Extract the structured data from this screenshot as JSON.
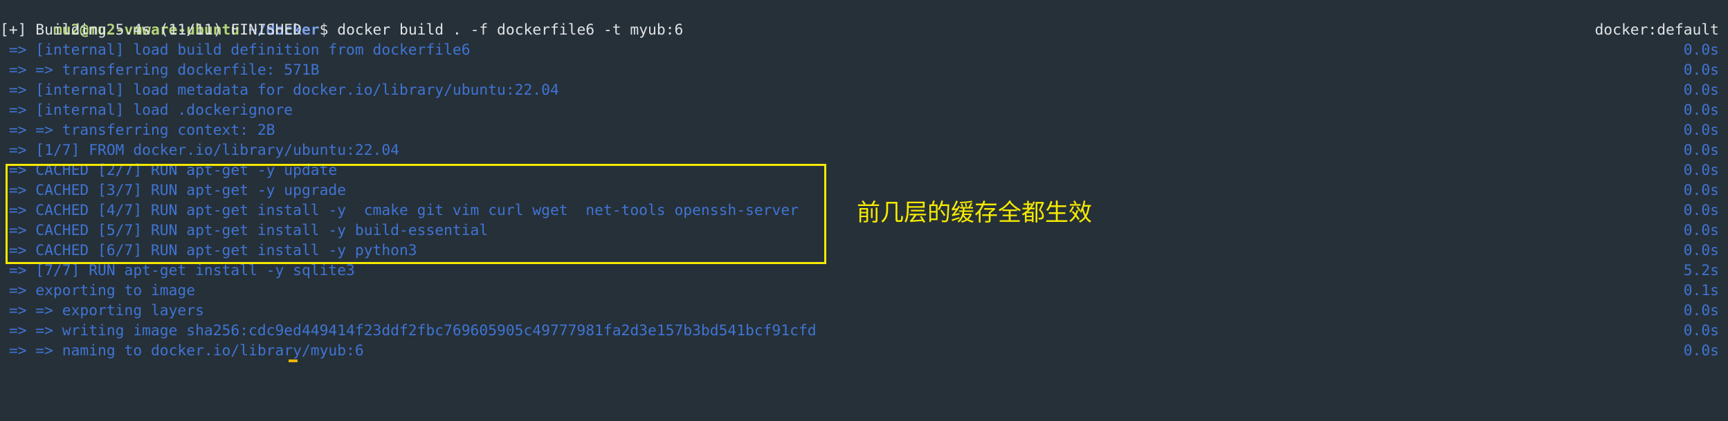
{
  "prompt": {
    "user_host": "mu2@mu2-vmware-ubuntu",
    "separator": ":",
    "path": "~/docker",
    "symbol": "$",
    "command": " docker build . -f dockerfile6 -t myub:6"
  },
  "status": {
    "text": "[+] Building 5.4s (11/11) FINISHED",
    "builder": "docker:default"
  },
  "steps": [
    {
      "text": " => [internal] load build definition from dockerfile6",
      "time": "0.0s"
    },
    {
      "text": " => => transferring dockerfile: 571B",
      "time": "0.0s"
    },
    {
      "text": " => [internal] load metadata for docker.io/library/ubuntu:22.04",
      "time": "0.0s"
    },
    {
      "text": " => [internal] load .dockerignore",
      "time": "0.0s"
    },
    {
      "text": " => => transferring context: 2B",
      "time": "0.0s"
    },
    {
      "text": " => [1/7] FROM docker.io/library/ubuntu:22.04",
      "time": "0.0s"
    },
    {
      "text": " => CACHED [2/7] RUN apt-get -y update",
      "time": "0.0s"
    },
    {
      "text": " => CACHED [3/7] RUN apt-get -y upgrade",
      "time": "0.0s"
    },
    {
      "text": " => CACHED [4/7] RUN apt-get install -y  cmake git vim curl wget  net-tools openssh-server",
      "time": "0.0s"
    },
    {
      "text": " => CACHED [5/7] RUN apt-get install -y build-essential",
      "time": "0.0s"
    },
    {
      "text": " => CACHED [6/7] RUN apt-get install -y python3",
      "time": "0.0s"
    },
    {
      "text": " => [7/7] RUN apt-get install -y sqlite3",
      "time": "5.2s"
    },
    {
      "text": " => exporting to image",
      "time": "0.1s"
    },
    {
      "text": " => => exporting layers",
      "time": "0.0s"
    },
    {
      "text": " => => writing image sha256:cdc9ed449414f23ddf2fbc769605905c49777981fa2d3e157b3bd541bcf91cfd",
      "time": "0.0s"
    },
    {
      "text": " => => naming to docker.io/library/myub:6",
      "time": "0.0s"
    }
  ],
  "annotation": {
    "text": "前几层的缓存全都生效",
    "color": "#f5ea00"
  },
  "colors": {
    "background": "#263038",
    "step_text": "#3f74d4",
    "plain_text": "#dfe3e6",
    "prompt_user": "#b5d67a",
    "prompt_path": "#7aa0e8"
  }
}
